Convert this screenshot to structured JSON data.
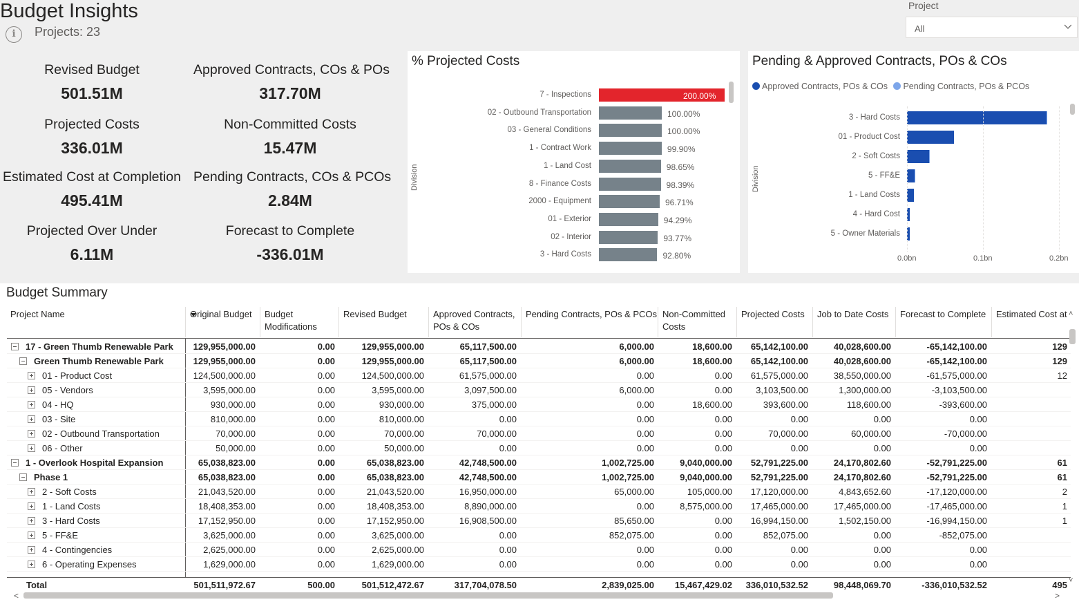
{
  "header": {
    "title": "Budget Insights",
    "projects_count": "Projects: 23",
    "slicer_label": "Project",
    "slicer_value": "All"
  },
  "kpis": [
    {
      "label": "Revised Budget",
      "value": "501.51M"
    },
    {
      "label": "Approved Contracts, COs & POs",
      "value": "317.70M"
    },
    {
      "label": "Projected Costs",
      "value": "336.01M"
    },
    {
      "label": "Non-Committed Costs",
      "value": "15.47M"
    },
    {
      "label": "Estimated Cost at Completion",
      "value": "495.41M"
    },
    {
      "label": "Pending Contracts, COs & PCOs",
      "value": "2.84M"
    },
    {
      "label": "Projected Over Under",
      "value": "6.11M"
    },
    {
      "label": "Forecast to Complete",
      "value": "-336.01M"
    }
  ],
  "chart_data": [
    {
      "type": "bar",
      "orientation": "horizontal",
      "title": "% Projected Costs",
      "ylabel": "Division",
      "categories": [
        "7 - Inspections",
        "02 - Outbound Transportation",
        "03 - General Conditions",
        "1 - Contract Work",
        "1 - Land Cost",
        "8 - Finance Costs",
        "2000 - Equipment",
        "01 - Exterior",
        "02 - Interior",
        "3 - Hard Costs"
      ],
      "values": [
        200.0,
        100.0,
        100.0,
        99.9,
        98.65,
        98.39,
        96.71,
        94.29,
        93.77,
        92.8
      ],
      "labels": [
        "200.00%",
        "100.00%",
        "100.00%",
        "99.90%",
        "98.65%",
        "98.39%",
        "96.71%",
        "94.29%",
        "93.77%",
        "92.80%"
      ],
      "highlight_color": "#e3252c",
      "bar_color": "#76828a"
    },
    {
      "type": "bar",
      "orientation": "horizontal",
      "title": "Pending & Approved Contracts, POs & COs",
      "ylabel": "Division",
      "categories": [
        "3 - Hard Costs",
        "01 - Product Cost",
        "2 - Soft Costs",
        "5 - FF&E",
        "1 - Land Costs",
        "4 - Hard Cost",
        "5 - Owner Materials"
      ],
      "series": [
        {
          "name": "Approved Contracts, POs & COs",
          "color": "#1a4eb0",
          "values": [
            0.1835,
            0.0616,
            0.0291,
            0.0103,
            0.0089,
            0.004,
            0.0035
          ]
        },
        {
          "name": "Pending Contracts, POs & PCOs",
          "color": "#7da6ea",
          "values": [
            0.0001,
            0.0,
            0.0001,
            0.0009,
            0.0,
            0.0,
            0.0
          ]
        }
      ],
      "xticks": [
        "0.0bn",
        "0.1bn",
        "0.2bn"
      ],
      "xlim": [
        0,
        0.2
      ],
      "legend": "top"
    }
  ],
  "table": {
    "title": "Budget Summary",
    "columns": [
      "Project Name",
      "Original Budget",
      "Budget Modifications",
      "Revised Budget",
      "Approved Contracts, POs & COs",
      "Pending Contracts, POs & PCOs",
      "Non-Committed Costs",
      "Projected Costs",
      "Job to Date Costs",
      "Forecast to Complete",
      "Estimated Cost at"
    ],
    "rows": [
      {
        "level": 0,
        "exp": "minus",
        "bold": true,
        "cells": [
          "17 - Green Thumb Renewable Park",
          "129,955,000.00",
          "0.00",
          "129,955,000.00",
          "65,117,500.00",
          "6,000.00",
          "18,600.00",
          "65,142,100.00",
          "40,028,600.00",
          "-65,142,100.00",
          "129"
        ]
      },
      {
        "level": 1,
        "exp": "minus",
        "bold": true,
        "cells": [
          "Green Thumb Renewable Park",
          "129,955,000.00",
          "0.00",
          "129,955,000.00",
          "65,117,500.00",
          "6,000.00",
          "18,600.00",
          "65,142,100.00",
          "40,028,600.00",
          "-65,142,100.00",
          "129"
        ]
      },
      {
        "level": 2,
        "exp": "plus",
        "bold": false,
        "cells": [
          "01 - Product Cost",
          "124,500,000.00",
          "0.00",
          "124,500,000.00",
          "61,575,000.00",
          "0.00",
          "0.00",
          "61,575,000.00",
          "38,550,000.00",
          "-61,575,000.00",
          "12"
        ]
      },
      {
        "level": 2,
        "exp": "plus",
        "bold": false,
        "cells": [
          "05 - Vendors",
          "3,595,000.00",
          "0.00",
          "3,595,000.00",
          "3,097,500.00",
          "6,000.00",
          "0.00",
          "3,103,500.00",
          "1,300,000.00",
          "-3,103,500.00",
          ""
        ]
      },
      {
        "level": 2,
        "exp": "plus",
        "bold": false,
        "cells": [
          "04 - HQ",
          "930,000.00",
          "0.00",
          "930,000.00",
          "375,000.00",
          "0.00",
          "18,600.00",
          "393,600.00",
          "118,600.00",
          "-393,600.00",
          ""
        ]
      },
      {
        "level": 2,
        "exp": "plus",
        "bold": false,
        "cells": [
          "03 - Site",
          "810,000.00",
          "0.00",
          "810,000.00",
          "0.00",
          "0.00",
          "0.00",
          "0.00",
          "0.00",
          "0.00",
          ""
        ]
      },
      {
        "level": 2,
        "exp": "plus",
        "bold": false,
        "cells": [
          "02 - Outbound Transportation",
          "70,000.00",
          "0.00",
          "70,000.00",
          "70,000.00",
          "0.00",
          "0.00",
          "70,000.00",
          "60,000.00",
          "-70,000.00",
          ""
        ]
      },
      {
        "level": 2,
        "exp": "plus",
        "bold": false,
        "cells": [
          "06 - Other",
          "50,000.00",
          "0.00",
          "50,000.00",
          "0.00",
          "0.00",
          "0.00",
          "0.00",
          "0.00",
          "0.00",
          ""
        ]
      },
      {
        "level": 0,
        "exp": "minus",
        "bold": true,
        "cells": [
          "1 - Overlook Hospital Expansion",
          "65,038,823.00",
          "0.00",
          "65,038,823.00",
          "42,748,500.00",
          "1,002,725.00",
          "9,040,000.00",
          "52,791,225.00",
          "24,170,802.60",
          "-52,791,225.00",
          "61"
        ]
      },
      {
        "level": 1,
        "exp": "minus",
        "bold": true,
        "cells": [
          "Phase 1",
          "65,038,823.00",
          "0.00",
          "65,038,823.00",
          "42,748,500.00",
          "1,002,725.00",
          "9,040,000.00",
          "52,791,225.00",
          "24,170,802.60",
          "-52,791,225.00",
          "61"
        ]
      },
      {
        "level": 2,
        "exp": "plus",
        "bold": false,
        "cells": [
          "2 - Soft Costs",
          "21,043,520.00",
          "0.00",
          "21,043,520.00",
          "16,950,000.00",
          "65,000.00",
          "105,000.00",
          "17,120,000.00",
          "4,843,652.60",
          "-17,120,000.00",
          "2"
        ]
      },
      {
        "level": 2,
        "exp": "plus",
        "bold": false,
        "cells": [
          "1 - Land Costs",
          "18,408,353.00",
          "0.00",
          "18,408,353.00",
          "8,890,000.00",
          "0.00",
          "8,575,000.00",
          "17,465,000.00",
          "17,465,000.00",
          "-17,465,000.00",
          "1"
        ]
      },
      {
        "level": 2,
        "exp": "plus",
        "bold": false,
        "cells": [
          "3 - Hard Costs",
          "17,152,950.00",
          "0.00",
          "17,152,950.00",
          "16,908,500.00",
          "85,650.00",
          "0.00",
          "16,994,150.00",
          "1,502,150.00",
          "-16,994,150.00",
          "1"
        ]
      },
      {
        "level": 2,
        "exp": "plus",
        "bold": false,
        "cells": [
          "5 - FF&E",
          "3,625,000.00",
          "0.00",
          "3,625,000.00",
          "0.00",
          "852,075.00",
          "0.00",
          "852,075.00",
          "0.00",
          "-852,075.00",
          ""
        ]
      },
      {
        "level": 2,
        "exp": "plus",
        "bold": false,
        "cells": [
          "4 - Contingencies",
          "2,625,000.00",
          "0.00",
          "2,625,000.00",
          "0.00",
          "0.00",
          "0.00",
          "0.00",
          "0.00",
          "0.00",
          ""
        ]
      },
      {
        "level": 2,
        "exp": "plus",
        "bold": false,
        "cells": [
          "6 - Operating Expenses",
          "1,629,000.00",
          "0.00",
          "1,629,000.00",
          "0.00",
          "0.00",
          "0.00",
          "0.00",
          "0.00",
          "0.00",
          ""
        ]
      }
    ],
    "total": [
      "Total",
      "501,511,972.67",
      "500.00",
      "501,512,472.67",
      "317,704,078.50",
      "2,839,025.00",
      "15,467,429.02",
      "336,010,532.52",
      "98,448,069.70",
      "-336,010,532.52",
      "495"
    ]
  }
}
